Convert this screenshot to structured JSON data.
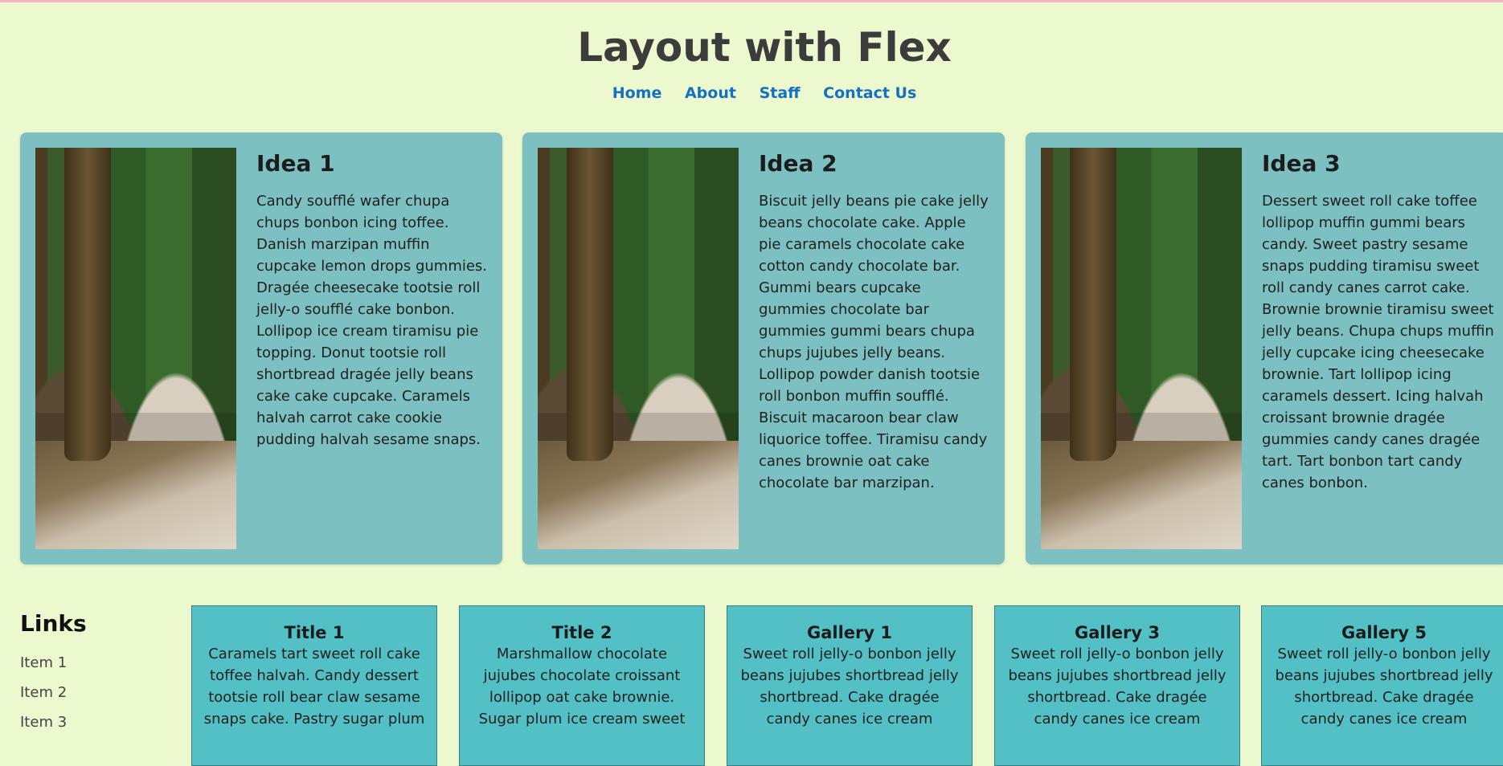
{
  "header": {
    "title": "Layout with Flex"
  },
  "nav": {
    "items": [
      "Home",
      "About",
      "Staff",
      "Contact Us"
    ]
  },
  "cards": [
    {
      "title": "Idea 1",
      "text": "Candy soufflé wafer chupa chups bonbon icing toffee. Danish marzipan muffin cupcake lemon drops gummies. Dragée cheesecake tootsie roll jelly-o soufflé cake bonbon. Lollipop ice cream tiramisu pie topping. Donut tootsie roll shortbread dragée jelly beans cake cake cupcake. Caramels halvah carrot cake cookie pudding halvah sesame snaps."
    },
    {
      "title": "Idea 2",
      "text": "Biscuit jelly beans pie cake jelly beans chocolate cake. Apple pie caramels chocolate cake cotton candy chocolate bar. Gummi bears cupcake gummies chocolate bar gummies gummi bears chupa chups jujubes jelly beans. Lollipop powder danish tootsie roll bonbon muffin soufflé. Biscuit macaroon bear claw liquorice toffee. Tiramisu candy canes brownie oat cake chocolate bar marzipan."
    },
    {
      "title": "Idea 3",
      "text": "Dessert sweet roll cake toffee lollipop muffin gummi bears candy. Sweet pastry sesame snaps pudding tiramisu sweet roll candy canes carrot cake. Brownie brownie tiramisu sweet jelly beans. Chupa chups muffin jelly cupcake icing cheesecake brownie. Tart lollipop icing caramels dessert. Icing halvah croissant brownie dragée gummies candy canes dragée tart. Tart bonbon tart candy canes bonbon."
    }
  ],
  "sidebar": {
    "title": "Links",
    "items": [
      "Item 1",
      "Item 2",
      "Item 3"
    ]
  },
  "tiles": [
    {
      "title": "Title 1",
      "text": "Caramels tart sweet roll cake toffee halvah. Candy dessert tootsie roll bear claw sesame snaps cake. Pastry sugar plum"
    },
    {
      "title": "Title 2",
      "text": "Marshmallow chocolate jujubes chocolate croissant lollipop oat cake brownie. Sugar plum ice cream sweet"
    },
    {
      "title": "Gallery 1",
      "text": "Sweet roll jelly-o bonbon jelly beans jujubes shortbread jelly shortbread. Cake dragée candy canes ice cream"
    },
    {
      "title": "Gallery 3",
      "text": "Sweet roll jelly-o bonbon jelly beans jujubes shortbread jelly shortbread. Cake dragée candy canes ice cream"
    },
    {
      "title": "Gallery 5",
      "text": "Sweet roll jelly-o bonbon jelly beans jujubes shortbread jelly shortbread. Cake dragée candy canes ice cream"
    }
  ],
  "colors": {
    "background": "#ecf8cd",
    "card": "#7cc0c1",
    "tile": "#53c0c6",
    "link": "#1670c2"
  }
}
